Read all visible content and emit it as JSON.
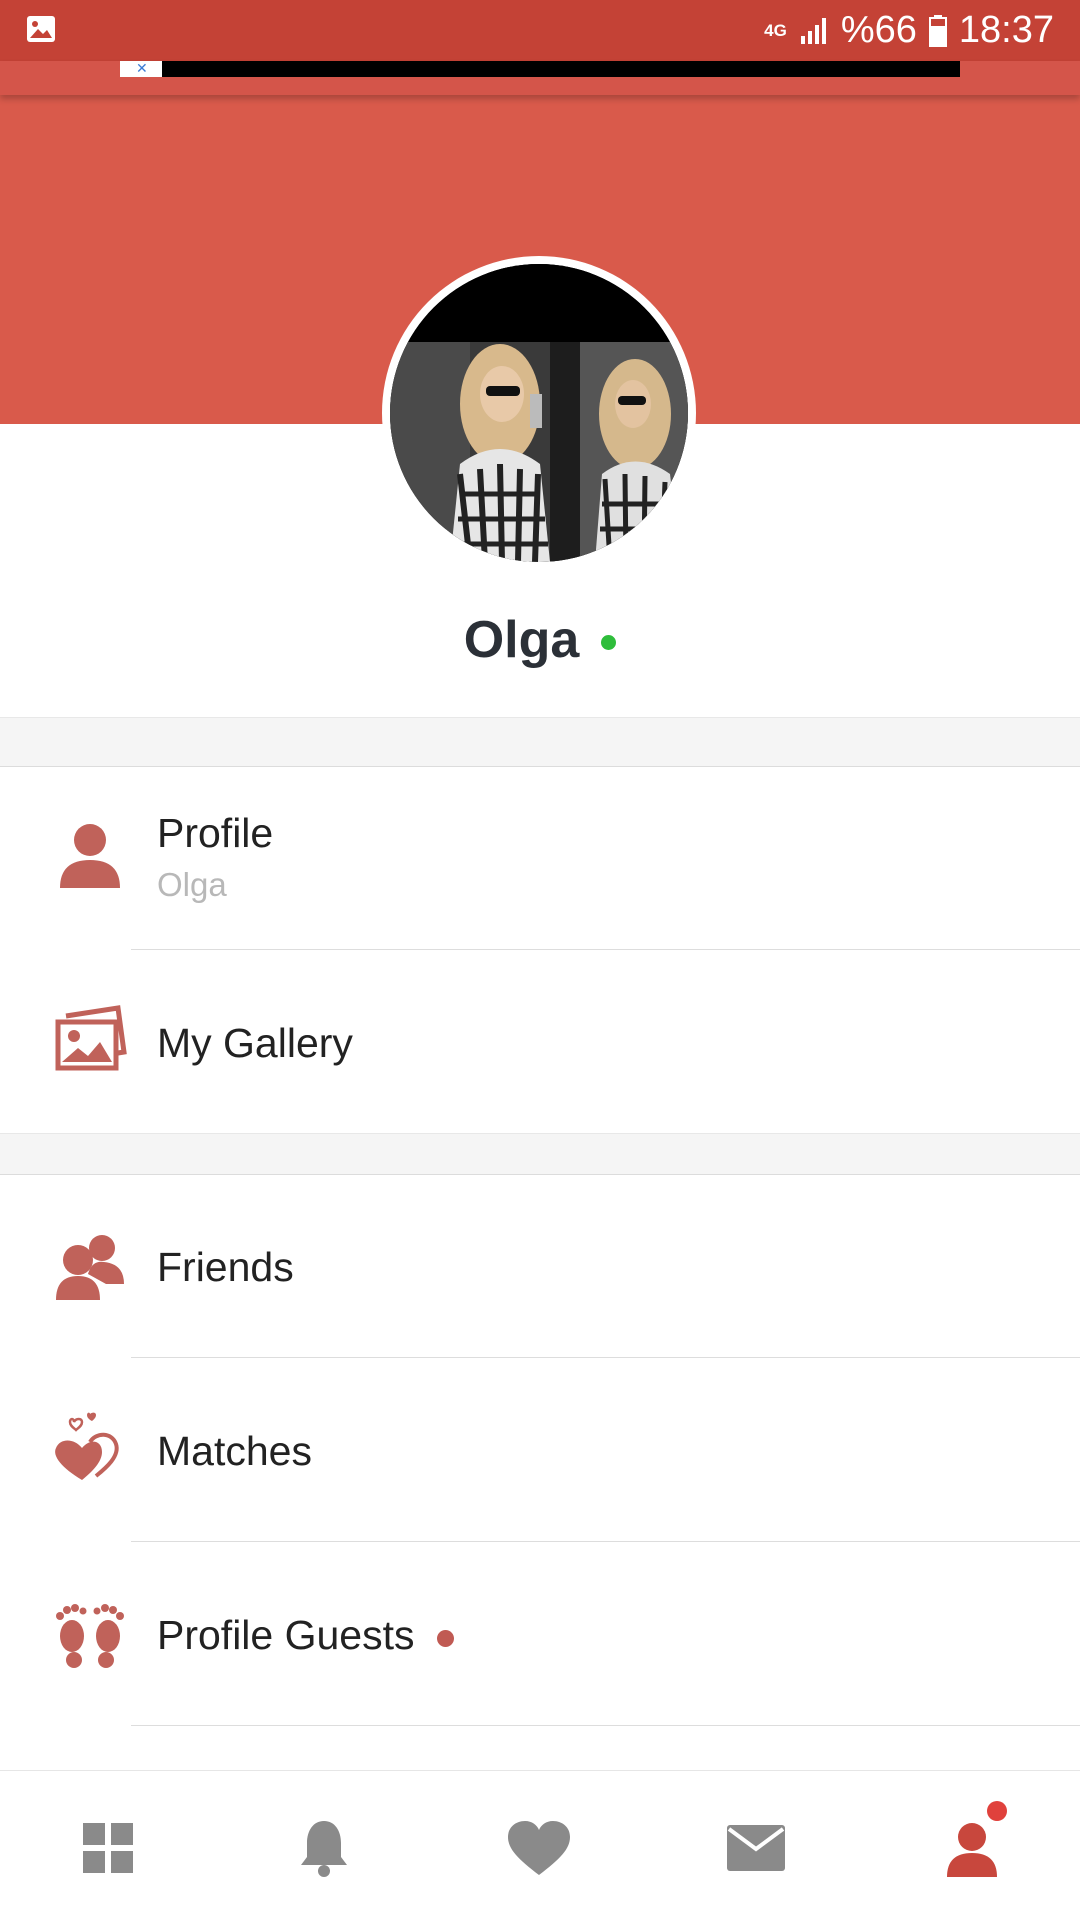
{
  "status_bar": {
    "network": "4G",
    "battery": "%66",
    "time": "18:37"
  },
  "profile": {
    "name": "Olga",
    "online": true
  },
  "menu": {
    "section1": [
      {
        "label": "Profile",
        "sub": "Olga",
        "icon": "person-icon"
      },
      {
        "label": "My Gallery",
        "icon": "gallery-icon"
      }
    ],
    "section2": [
      {
        "label": "Friends",
        "icon": "friends-icon"
      },
      {
        "label": "Matches",
        "icon": "hearts-icon"
      },
      {
        "label": "Profile Guests",
        "icon": "footprints-icon",
        "badge": true
      }
    ]
  },
  "bottom_nav": [
    {
      "name": "dashboard",
      "icon": "grid-icon",
      "active": false
    },
    {
      "name": "notifications",
      "icon": "bell-icon",
      "active": false
    },
    {
      "name": "likes",
      "icon": "heart-icon",
      "active": false
    },
    {
      "name": "messages",
      "icon": "envelope-icon",
      "active": false
    },
    {
      "name": "my-profile",
      "icon": "person-icon",
      "active": true,
      "badge": true
    }
  ],
  "colors": {
    "status_bar": "#c44236",
    "header": "#d95a4b",
    "icon_accent": "#c0625a",
    "online": "#2ebd3b",
    "nav_inactive": "#8a8a8a",
    "nav_active": "#c8473d"
  }
}
